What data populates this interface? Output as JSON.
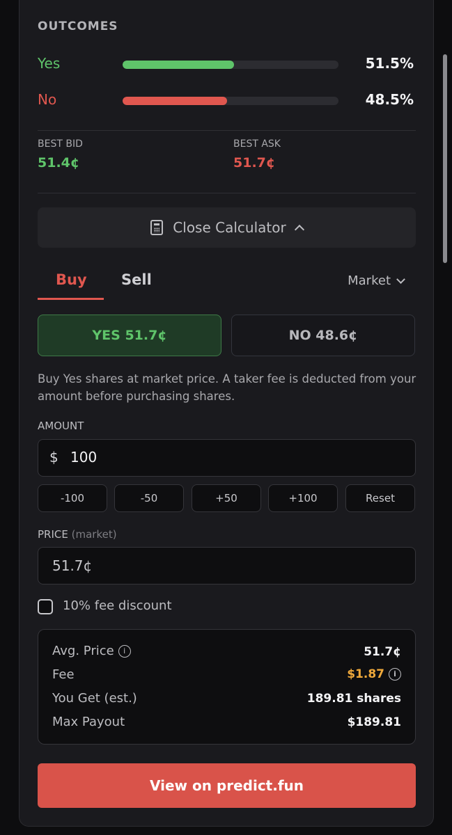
{
  "outcomes": {
    "title": "OUTCOMES",
    "items": [
      {
        "label": "Yes",
        "percent_text": "51.5%",
        "percent": 51.5,
        "color": "#5fc46a"
      },
      {
        "label": "No",
        "percent_text": "48.5%",
        "percent": 48.5,
        "color": "#e0574f"
      }
    ]
  },
  "book": {
    "best_bid_label": "BEST BID",
    "best_bid": "51.4¢",
    "best_ask_label": "BEST ASK",
    "best_ask": "51.7¢"
  },
  "calculator": {
    "toggle_label": "Close Calculator",
    "icon": "calculator-icon"
  },
  "trade": {
    "tabs": [
      "Buy",
      "Sell"
    ],
    "active_tab": "Buy",
    "order_type": "Market",
    "yes_button": "YES 51.7¢",
    "no_button": "NO 48.6¢",
    "description": "Buy Yes shares at market price. A taker fee is deducted from your amount before purchasing shares.",
    "amount_label": "AMOUNT",
    "currency_symbol": "$",
    "amount_value": "100",
    "quick_buttons": [
      "-100",
      "-50",
      "+50",
      "+100",
      "Reset"
    ],
    "price_label": "PRICE",
    "price_label_hint": "(market)",
    "price_value": "51.7¢",
    "fee_discount_label": "10% fee discount",
    "fee_discount_checked": false
  },
  "summary": {
    "avg_price_label": "Avg. Price",
    "avg_price": "51.7¢",
    "fee_label": "Fee",
    "fee": "$1.87",
    "you_get_label": "You Get (est.)",
    "you_get": "189.81 shares",
    "max_payout_label": "Max Payout",
    "max_payout": "$189.81"
  },
  "cta": {
    "label": "View on predict.fun"
  },
  "colors": {
    "green": "#5fc46a",
    "red": "#e0574f",
    "fee": "#f0a93b",
    "cta": "#d9534a"
  }
}
